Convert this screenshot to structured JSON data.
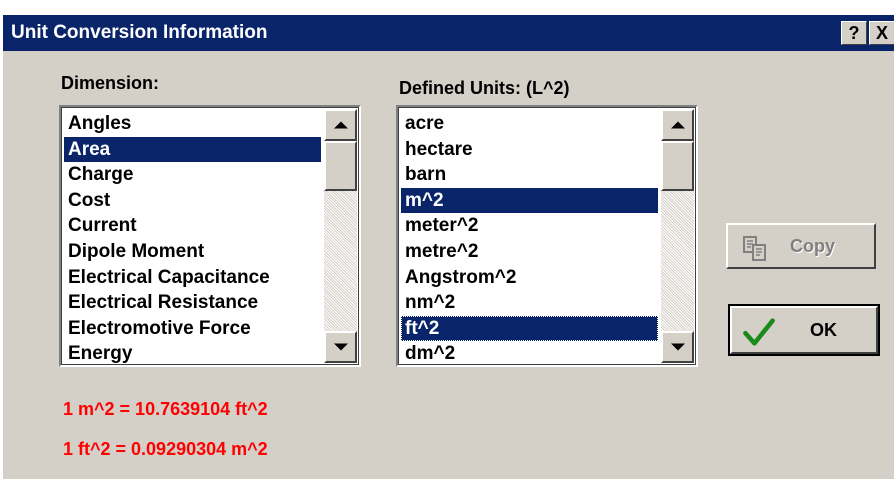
{
  "window": {
    "title": "Unit Conversion Information",
    "help_label": "?",
    "close_label": "X"
  },
  "dimension": {
    "label": "Dimension:",
    "items": [
      "Angles",
      "Area",
      "Charge",
      "Cost",
      "Current",
      "Dipole Moment",
      "Electrical Capacitance",
      "Electrical Resistance",
      "Electromotive Force",
      "Energy"
    ],
    "selected": "Area"
  },
  "units": {
    "label": "Defined Units:  (L^2)",
    "items": [
      "acre",
      "hectare",
      "barn",
      "m^2",
      "meter^2",
      "metre^2",
      "Angstrom^2",
      "nm^2",
      "ft^2",
      "dm^2"
    ],
    "selected": [
      "m^2",
      "ft^2"
    ]
  },
  "buttons": {
    "copy_label": "Copy",
    "copy_enabled": false,
    "ok_label": "OK"
  },
  "results": {
    "line1": "1 m^2 = 10.7639104 ft^2",
    "line2": "1 ft^2 = 0.09290304 m^2"
  },
  "colors": {
    "title_bar": "#0a246a",
    "dialog_face": "#d4d0c8",
    "selection": "#0a246a",
    "result_text": "#ff0000",
    "check_mark": "#1b8a1b"
  }
}
